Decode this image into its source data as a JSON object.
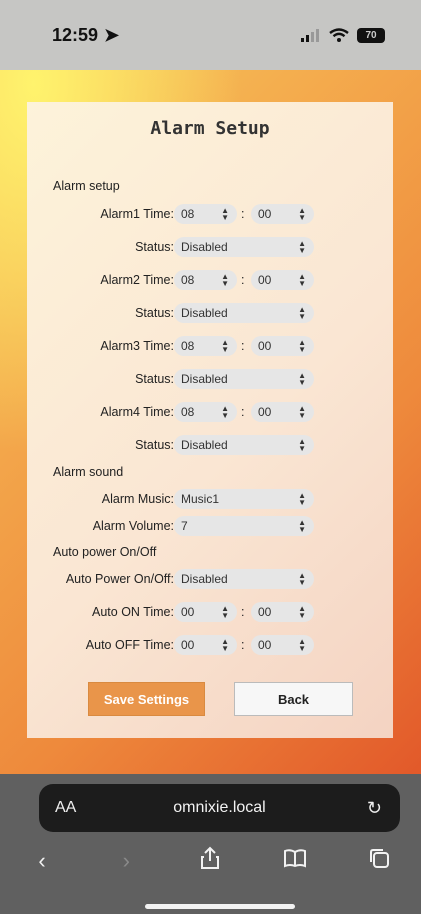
{
  "status_bar": {
    "time": "12:59",
    "battery": "70"
  },
  "page": {
    "title": "Alarm Setup",
    "sections": {
      "alarm_setup": "Alarm setup",
      "alarm_sound": "Alarm sound",
      "auto_power": "Auto power On/Off"
    },
    "alarms": [
      {
        "label": "Alarm1 Time:",
        "hour": "08",
        "minute": "00",
        "status_label": "Status:",
        "status": "Disabled"
      },
      {
        "label": "Alarm2 Time:",
        "hour": "08",
        "minute": "00",
        "status_label": "Status:",
        "status": "Disabled"
      },
      {
        "label": "Alarm3 Time:",
        "hour": "08",
        "minute": "00",
        "status_label": "Status:",
        "status": "Disabled"
      },
      {
        "label": "Alarm4 Time:",
        "hour": "08",
        "minute": "00",
        "status_label": "Status:",
        "status": "Disabled"
      }
    ],
    "sound": {
      "music_label": "Alarm Music:",
      "music": "Music1",
      "volume_label": "Alarm Volume:",
      "volume": "7"
    },
    "auto": {
      "power_label": "Auto Power On/Off:",
      "power": "Disabled",
      "on_label": "Auto ON Time:",
      "on_hour": "00",
      "on_minute": "00",
      "off_label": "Auto OFF Time:",
      "off_hour": "00",
      "off_minute": "00"
    },
    "colon": ":",
    "buttons": {
      "save": "Save Settings",
      "back": "Back"
    }
  },
  "browser": {
    "aa": "AA",
    "url": "omnixie.local",
    "icons": [
      "back-icon",
      "forward-icon",
      "share-icon",
      "bookmarks-icon",
      "tabs-icon",
      "reload-icon",
      "location-arrow-icon"
    ]
  }
}
